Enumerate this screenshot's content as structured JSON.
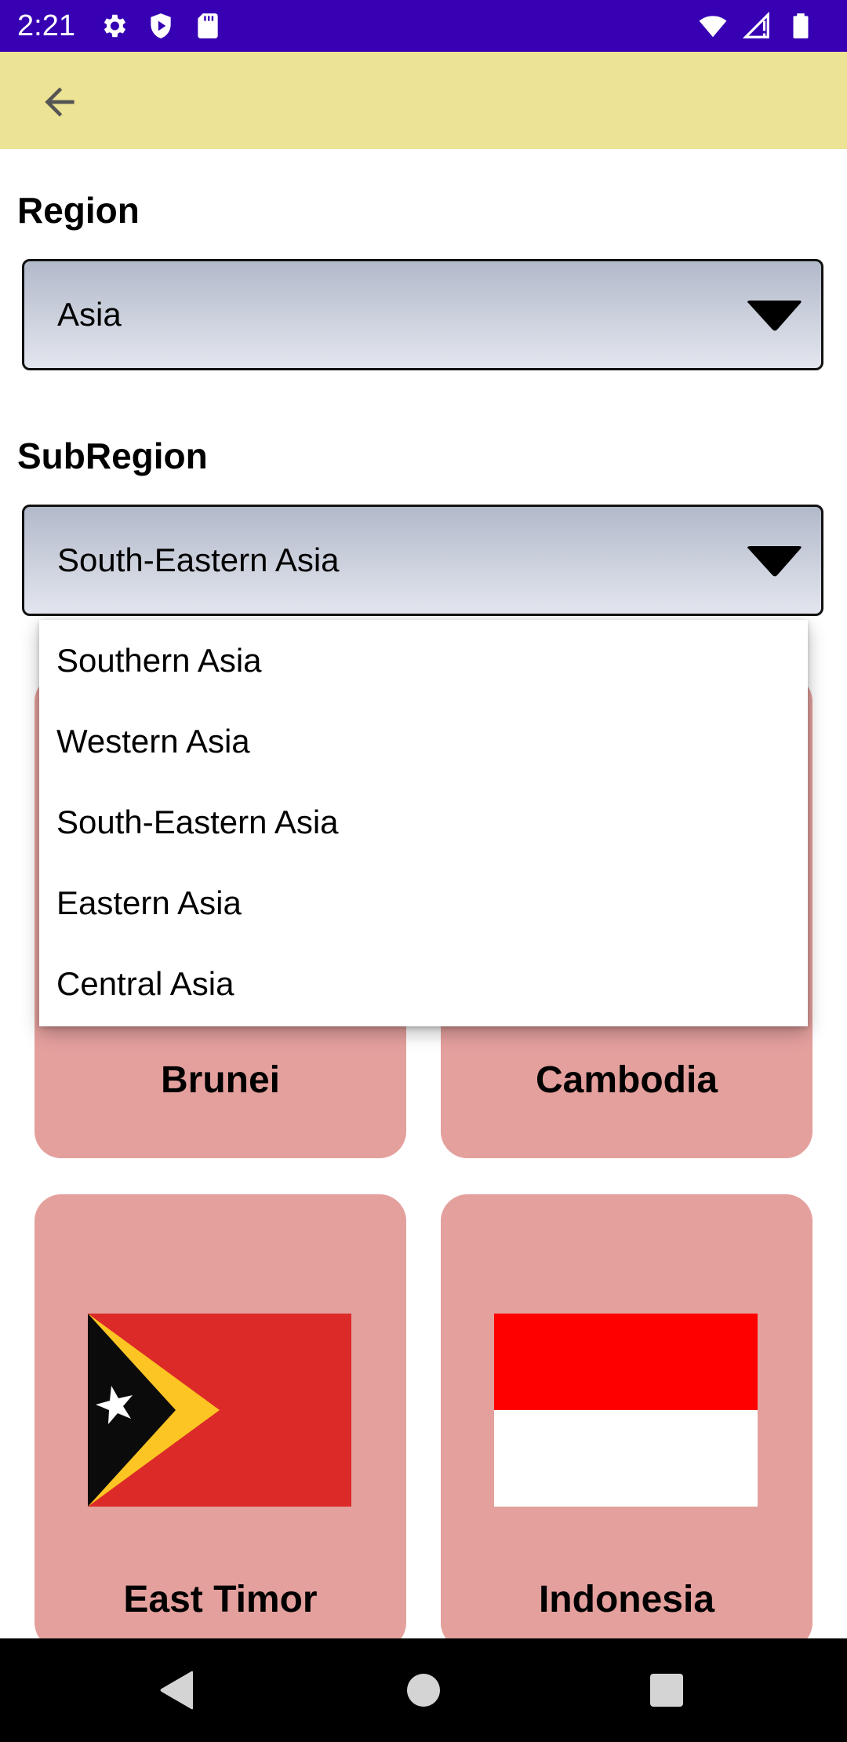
{
  "status_bar": {
    "time": "2:21",
    "left_icons": [
      "gear-icon",
      "shield-icon",
      "sd-card-icon"
    ],
    "right_icons": [
      "wifi-icon",
      "signal-icon",
      "battery-icon"
    ],
    "background": "#3700b3"
  },
  "app_bar": {
    "background": "#ede394",
    "back_icon": "arrow-left-icon"
  },
  "region": {
    "label": "Region",
    "selected": "Asia"
  },
  "subregion": {
    "label": "SubRegion",
    "selected": "South-Eastern Asia",
    "options": [
      "Southern Asia",
      "Western Asia",
      "South-Eastern Asia",
      "Eastern Asia",
      "Central Asia"
    ]
  },
  "countries": [
    {
      "name": "Brunei"
    },
    {
      "name": "Cambodia"
    },
    {
      "name": "East Timor",
      "flag": "timor-leste-flag"
    },
    {
      "name": "Indonesia",
      "flag": "indonesia-flag"
    }
  ],
  "nav_bar": {
    "buttons": [
      "back-triangle-icon",
      "home-circle-icon",
      "recents-square-icon"
    ]
  },
  "colors": {
    "card": "#e4a09d",
    "spinner_gradient_top": "#b2b9ca",
    "spinner_gradient_bottom": "#e3e6ee"
  }
}
